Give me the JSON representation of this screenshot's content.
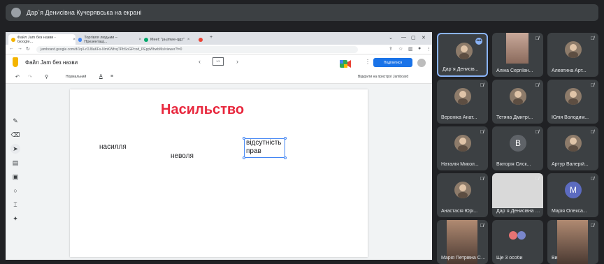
{
  "banner": {
    "text": "Дар`я Денисівна Кучерявська на екрані"
  },
  "browser": {
    "tabs": [
      {
        "label": "Файл Jam без назви - Google...",
        "fav": "#f4b400",
        "active": true
      },
      {
        "label": "Торгівля людьми – Презентаці...",
        "fav": "#4285f4",
        "active": false
      },
      {
        "label": "Meet: \"ja-jmwe-qgz\"",
        "fav": "#00a86b",
        "active": false
      },
      {
        "label": "",
        "fav": "#ea4335",
        "active": false
      }
    ],
    "url": "jamboard.google.com/d/1qX-rDJ8aKFs-NmKWfvqTPbSoGPcod_PEppWhwbMs/viewer?f=0"
  },
  "jam": {
    "title": "Файл Jam без назви",
    "frame_indicator": "1/1",
    "share_label": "Поділитися",
    "toolbar_zoom": "Нормальний",
    "open_on_device": "Відкрити на пристрої Jamboard",
    "heading": "Насильство",
    "words": [
      "насилля",
      "неволя",
      "відсутність",
      "прав"
    ]
  },
  "participants": [
    {
      "name": "Дар`я Денисів...",
      "type": "avatar",
      "active": true
    },
    {
      "name": "Аліна Сергіївн...",
      "type": "photo"
    },
    {
      "name": "Алевтина Арт...",
      "type": "avatar"
    },
    {
      "name": "Вероніка Анат...",
      "type": "avatar"
    },
    {
      "name": "Тетяна Дмитрі...",
      "type": "avatar"
    },
    {
      "name": "Юлія Володим...",
      "type": "avatar"
    },
    {
      "name": "Наталія Микол...",
      "type": "avatar"
    },
    {
      "name": "Вікторія Олск...",
      "type": "letter",
      "letter": "В",
      "color": "#5f6368"
    },
    {
      "name": "Артур Валерій...",
      "type": "avatar"
    },
    {
      "name": "Анастасія Юрі...",
      "type": "avatar"
    },
    {
      "name": "Дар`я Денисівна Кучерявська",
      "type": "screen"
    },
    {
      "name": "Марія Олекса...",
      "type": "letter",
      "letter": "М",
      "color": "#5c6bc0"
    },
    {
      "name": "Марія Петрівна Сингаївсь",
      "type": "video"
    },
    {
      "name": "Ще 3 особи",
      "type": "more"
    },
    {
      "name": "Ви",
      "type": "video"
    }
  ],
  "colors": {
    "accent": "#1a73e8",
    "heading": "#e8273d",
    "bg": "#202124",
    "tile": "#3c4043"
  }
}
